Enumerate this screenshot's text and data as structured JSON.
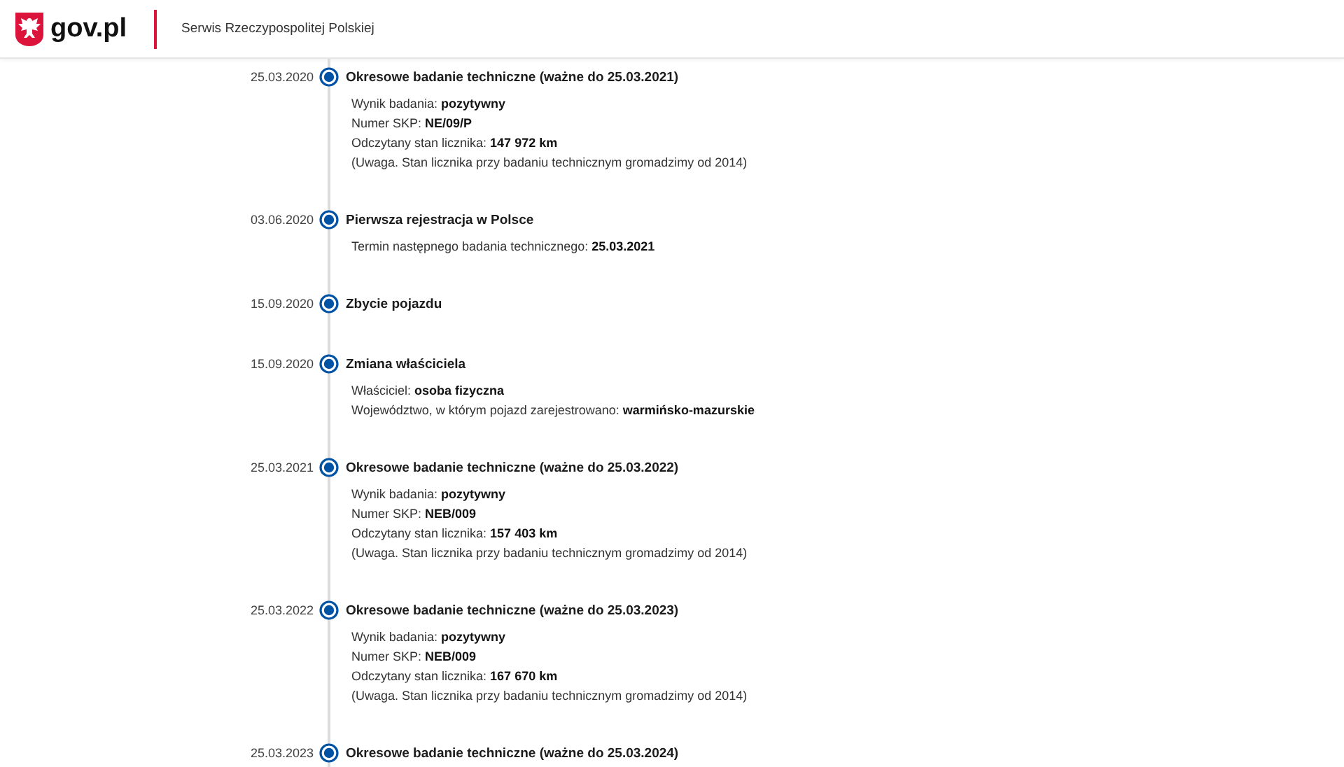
{
  "header": {
    "logo_text": "gov.pl",
    "tagline": "Serwis Rzeczypospolitej Polskiej"
  },
  "timeline": [
    {
      "date": "25.03.2020",
      "title": "Okresowe badanie techniczne (ważne do 25.03.2021)",
      "details": [
        "Wynik badania: **pozytywny**",
        "Numer SKP: **NE/09/P**",
        "Odczytany stan licznika: **147 972 km**",
        "(Uwaga. Stan licznika przy badaniu technicznym gromadzimy od 2014)"
      ]
    },
    {
      "date": "03.06.2020",
      "title": "Pierwsza rejestracja w Polsce",
      "details": [
        "Termin następnego badania technicznego: **25.03.2021**"
      ]
    },
    {
      "date": "15.09.2020",
      "title": "Zbycie pojazdu"
    },
    {
      "date": "15.09.2020",
      "title": "Zmiana właściciela",
      "details": [
        "Właściciel: **osoba fizyczna**",
        "Województwo, w którym pojazd zarejestrowano: **warmińsko-mazurskie**"
      ]
    },
    {
      "date": "25.03.2021",
      "title": "Okresowe badanie techniczne (ważne do 25.03.2022)",
      "details": [
        "Wynik badania: **pozytywny**",
        "Numer SKP: **NEB/009**",
        "Odczytany stan licznika: **157 403 km**",
        "(Uwaga. Stan licznika przy badaniu technicznym gromadzimy od 2014)"
      ]
    },
    {
      "date": "25.03.2022",
      "title": "Okresowe badanie techniczne (ważne do 25.03.2023)",
      "details": [
        "Wynik badania: **pozytywny**",
        "Numer SKP: **NEB/009**",
        "Odczytany stan licznika: **167 670 km**",
        "(Uwaga. Stan licznika przy badaniu technicznym gromadzimy od 2014)"
      ]
    },
    {
      "date": "25.03.2023",
      "title": "Okresowe badanie techniczne (ważne do 25.03.2024)"
    }
  ]
}
